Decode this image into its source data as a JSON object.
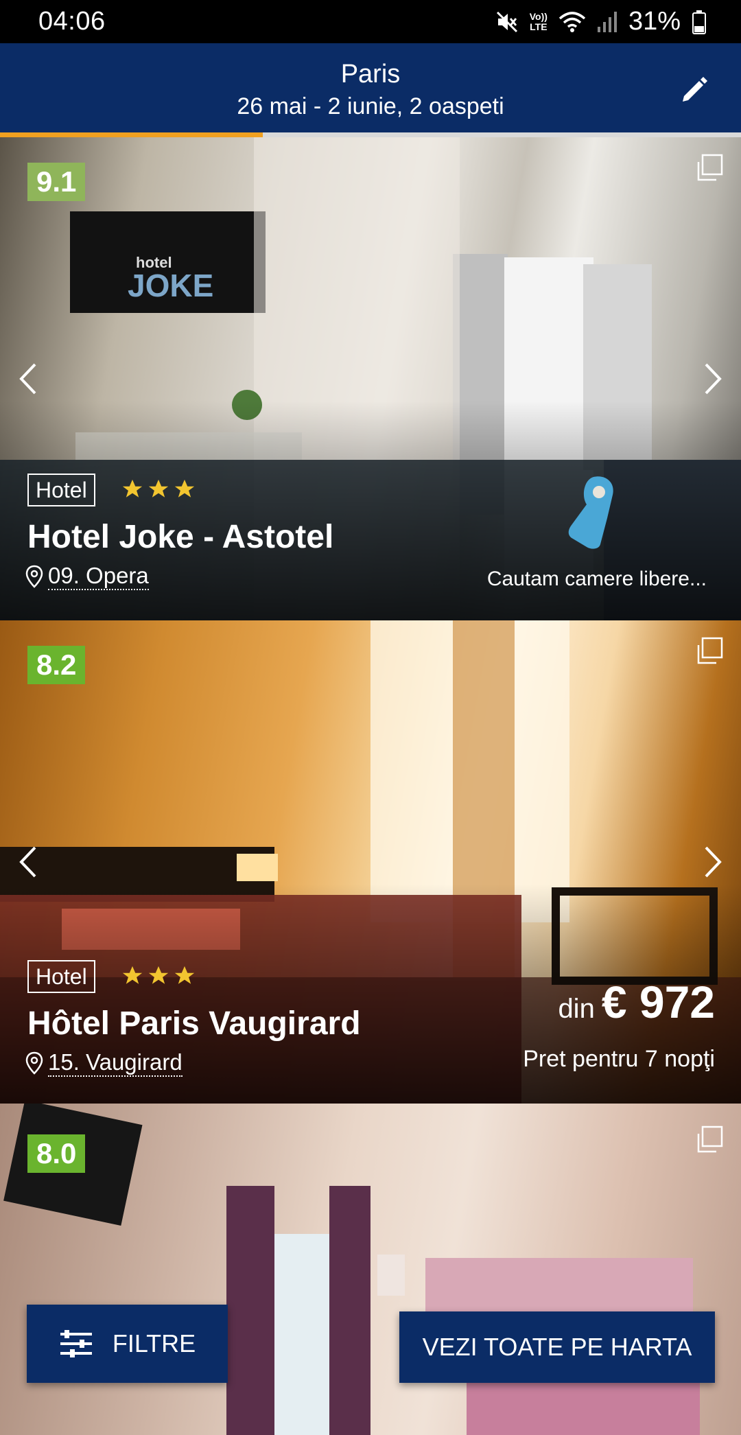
{
  "status_bar": {
    "time": "04:06",
    "volte_top": "Vo))",
    "volte_bottom": "LTE",
    "battery": "31%",
    "icons": [
      "mute-icon",
      "volte-icon",
      "wifi-icon",
      "signal-icon",
      "battery-icon"
    ]
  },
  "header": {
    "title": "Paris",
    "subtitle": "26 mai - 2 iunie, 2 oaspeti",
    "edit_icon": "pencil-icon"
  },
  "loading_progress": 0.355,
  "colors": {
    "header_bg": "#0b2c66",
    "progress": "#f0a020",
    "star": "#f2c530",
    "score_green": "#6ab42e",
    "score_light": "#8fb55a",
    "tag_icon": "#4aa7d6"
  },
  "hotels": [
    {
      "score": "9.1",
      "type": "Hotel",
      "stars": 3,
      "name": "Hotel Joke - Astotel",
      "location": "09. Opera",
      "availability": "Cautam camere libere..."
    },
    {
      "score": "8.2",
      "type": "Hotel",
      "stars": 3,
      "name": "Hôtel Paris Vaugirard",
      "location": "15. Vaugirard",
      "price_from": "din",
      "price": "€ 972",
      "price_note": "Pret pentru 7 nopţi"
    },
    {
      "score": "8.0"
    }
  ],
  "buttons": {
    "filters": "FILTRE",
    "map": "VEZI TOATE PE HARTA"
  }
}
